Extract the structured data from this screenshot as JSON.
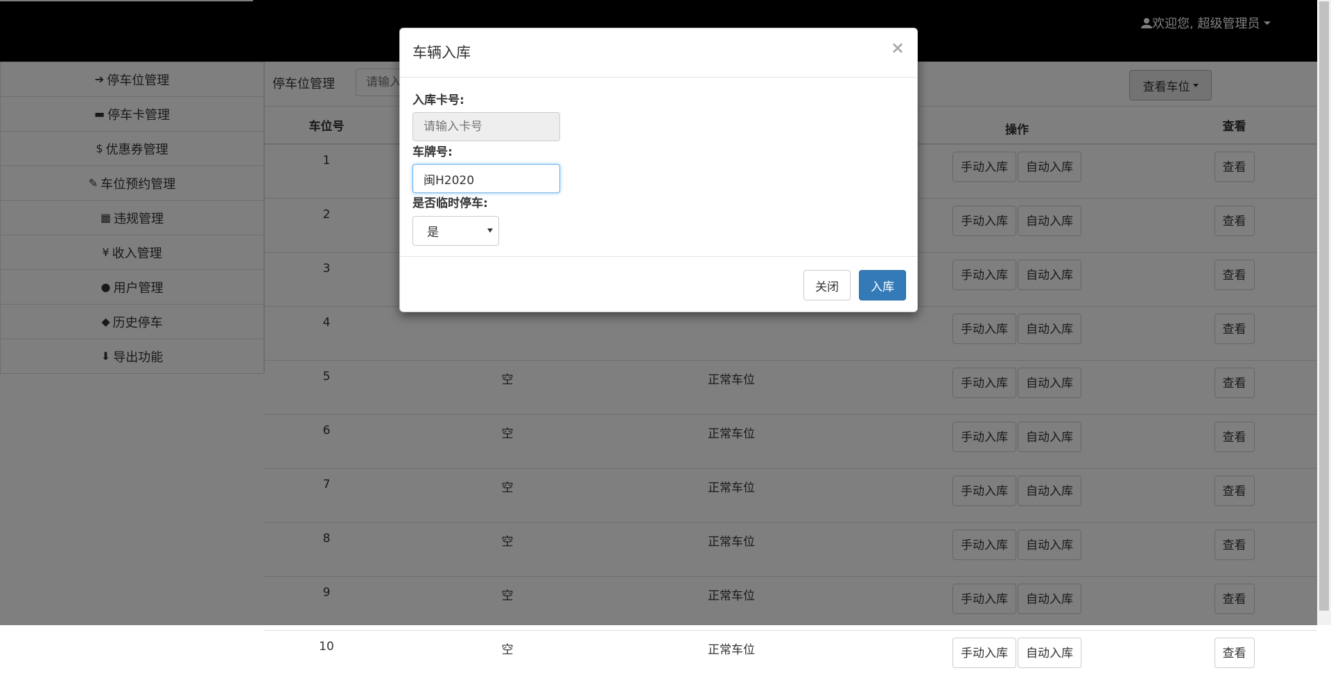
{
  "header": {
    "user_greeting": "欢迎您, 超级管理员"
  },
  "sidebar": {
    "items": [
      {
        "label": "停车位管理",
        "icon": "sign-in-icon"
      },
      {
        "label": "停车卡管理",
        "icon": "credit-card-icon"
      },
      {
        "label": "优惠券管理",
        "icon": "dollar-icon"
      },
      {
        "label": "车位预约管理",
        "icon": "pushpin-icon"
      },
      {
        "label": "违规管理",
        "icon": "th-large-icon"
      },
      {
        "label": "收入管理",
        "icon": "yen-icon"
      },
      {
        "label": "用户管理",
        "icon": "user-icon"
      },
      {
        "label": "历史停车",
        "icon": "tags-icon"
      },
      {
        "label": "导出功能",
        "icon": "download-icon"
      }
    ]
  },
  "main": {
    "breadcrumb": "停车位管理",
    "search_placeholder": "请输入",
    "view_button": "查看车位",
    "table": {
      "headers": [
        "车位号",
        "",
        "",
        "操作",
        "查看"
      ],
      "rows": [
        {
          "num": "1",
          "state": "",
          "type": ""
        },
        {
          "num": "2",
          "state": "",
          "type": ""
        },
        {
          "num": "3",
          "state": "",
          "type": ""
        },
        {
          "num": "4",
          "state": "",
          "type": ""
        },
        {
          "num": "5",
          "state": "空",
          "type": "正常车位"
        },
        {
          "num": "6",
          "state": "空",
          "type": "正常车位"
        },
        {
          "num": "7",
          "state": "空",
          "type": "正常车位"
        },
        {
          "num": "8",
          "state": "空",
          "type": "正常车位"
        },
        {
          "num": "9",
          "state": "空",
          "type": "正常车位"
        },
        {
          "num": "10",
          "state": "空",
          "type": "正常车位"
        }
      ],
      "manual_btn": "手动入库",
      "auto_btn": "自动入库",
      "view_btn": "查看"
    }
  },
  "modal": {
    "title": "车辆入库",
    "close_symbol": "×",
    "card_label": "入库卡号:",
    "card_placeholder": "请输入卡号",
    "plate_label": "车牌号:",
    "plate_value": "闽H2020",
    "temp_label": "是否临时停车:",
    "temp_value": "是",
    "close_button": "关闭",
    "submit_button": "入库"
  },
  "colors": {
    "primary": "#337ab7",
    "topbar": "#000000",
    "overlay": "rgba(0,0,0,0.5)"
  }
}
